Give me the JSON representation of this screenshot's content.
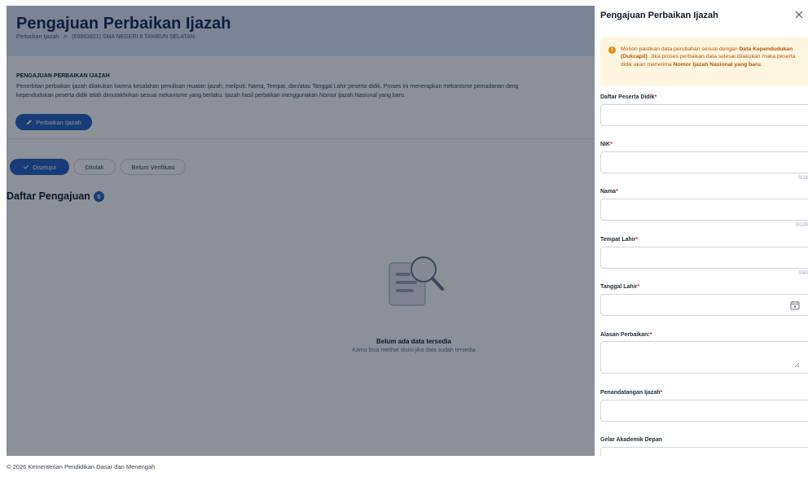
{
  "header": {
    "title": "Pengajuan Perbaikan Ijazah",
    "breadcrumb": [
      "Perbaikan Ijazah",
      ">",
      "(69983821) SMA NEGERI 9 TAMBUN SELATAN"
    ]
  },
  "info": {
    "title": "PENGAJUAN PERBAIKAN IJAZAH",
    "line1": "Penerbitan perbaikan ijazah dilakukan karena kesalahan penulisan muatan ijazah, meliputi: Nama, Tempat, dan/atau Tanggal Lahir peserta didik. Proses ini menerapkan mekanisme pemadanan deng",
    "line2": "kependudukan peserta didik telah dimutakhirkan sesuai mekanisme yang berlaku. Ijazah hasil perbaikan menggunakan Nomor Ijazah Nasional yang baru.",
    "button_label": "Perbaikan Ijazah"
  },
  "filters": [
    "Disetujui",
    "Ditolak",
    "Belum Verifikasi"
  ],
  "list": {
    "title": "Daftar Pengajuan",
    "count": "0",
    "empty_title": "Belum ada data tersedia",
    "empty_subtitle": "Kamu bisa melihat disini jika data sudah tersedia"
  },
  "footer": "© 2026 Kementerian Pendidikan Dasar dan Menengah",
  "drawer": {
    "title": "Pengajuan Perbaikan Ijazah",
    "close_icon": "close-icon",
    "alert": {
      "text_1": "Mohon pastikan data perubahan sesuai dengan ",
      "bold_1": "Data Kependudukan (Dukcapil)",
      "text_2": ". Jika proses perbaikan data selesai dilakukan maka peserta didik akan menerima ",
      "bold_2": "Nomor Ijazah Nasional yang baru",
      "text_3": "."
    },
    "fields": [
      {
        "label": "Daftar Peserta Didik",
        "required": "*",
        "value": "",
        "counter": ""
      },
      {
        "label": "NIK",
        "required": "*",
        "value": "",
        "counter": "0/16"
      },
      {
        "label": "Nama",
        "required": "*",
        "value": "",
        "counter": "0/100"
      },
      {
        "label": "Tempat Lahir",
        "required": "*",
        "value": "",
        "counter": "0/80"
      },
      {
        "label": "Tanggal Lahir",
        "required": "*",
        "value": "",
        "counter": ""
      },
      {
        "label": "Alasan Perbaikan:",
        "required": "*",
        "value": "",
        "counter": ""
      },
      {
        "label": "Penandatangan Ijazah",
        "required": "*",
        "value": "",
        "counter": ""
      },
      {
        "label": "Gelar Akademik Depan",
        "required": "",
        "value": "",
        "counter": ""
      }
    ]
  },
  "colors": {
    "primary": "#1f5fbf",
    "hero_bg": "#dfe8f7",
    "alert_bg": "#fff6e0",
    "alert_text": "#b45309",
    "required": "#dc2626"
  }
}
